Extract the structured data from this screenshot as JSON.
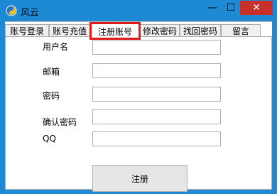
{
  "window": {
    "title": "风云",
    "controls": {
      "minimize": "—",
      "maximize": "☐",
      "close": "✕"
    },
    "accent": "#1e8ad6",
    "close_color": "#c7312a",
    "icon": "app-logo-icon"
  },
  "tabs": [
    {
      "label": "账号登录",
      "active": false
    },
    {
      "label": "账号充值",
      "active": false
    },
    {
      "label": "注册账号",
      "active": true
    },
    {
      "label": "修改密码",
      "active": false
    },
    {
      "label": "找回密码",
      "active": false
    },
    {
      "label": "留言",
      "active": false
    }
  ],
  "form": {
    "username": {
      "label": "用户名",
      "value": ""
    },
    "email": {
      "label": "邮箱",
      "value": ""
    },
    "password": {
      "label": "密码",
      "value": ""
    },
    "confirm_password": {
      "label": "确认密码",
      "value": ""
    },
    "qq": {
      "label": "QQ",
      "value": ""
    },
    "submit_label": "注册"
  },
  "highlight_color": "#e01b1b"
}
